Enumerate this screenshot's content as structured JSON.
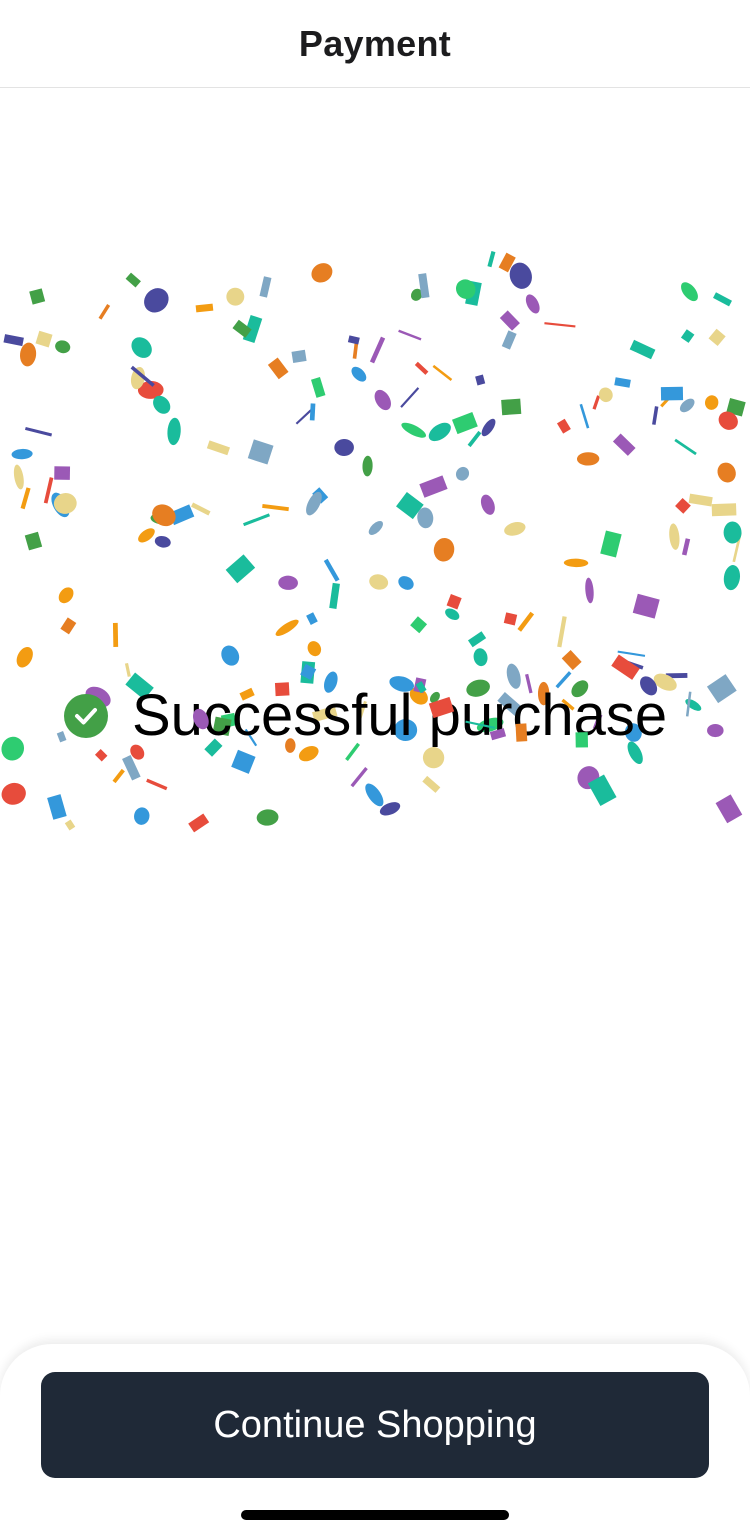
{
  "header": {
    "title": "Payment"
  },
  "status": {
    "message": "Successful purchase",
    "icon": "check-circle-icon",
    "icon_color": "#43a047"
  },
  "confetti": {
    "icon": "confetti-icon",
    "colors": [
      "#e74c3c",
      "#f39c12",
      "#2ecc71",
      "#3498db",
      "#9b59b6",
      "#1abc9c",
      "#e67e22",
      "#4a4a9e",
      "#e8d58a",
      "#7fa7c4",
      "#43a047"
    ]
  },
  "footer": {
    "button_label": "Continue Shopping",
    "button_color": "#1f2937"
  }
}
